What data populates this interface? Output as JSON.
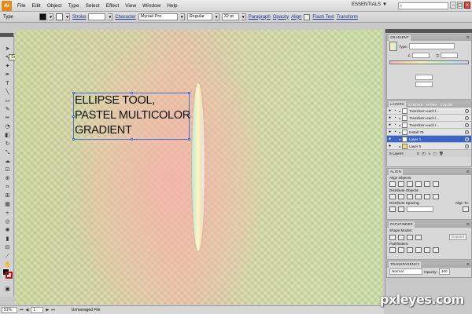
{
  "menubar": {
    "logo": "Ai",
    "items": [
      "File",
      "Edit",
      "Object",
      "Type",
      "Select",
      "Effect",
      "View",
      "Window",
      "Help"
    ],
    "workspace": "ESSENTIALS",
    "workspace_arrow": "▼"
  },
  "control_bar": {
    "selection_type": "Type",
    "stroke_label": "Stroke",
    "character_label": "Character",
    "font_family": "Myriad Pro",
    "font_style": "Regular",
    "font_size": "32 pt",
    "paragraph_label": "Paragraph",
    "opacity_label": "Opacity",
    "align_label": "Align",
    "flash_text_label": "Flash Text",
    "transform_label": "Transform"
  },
  "toolbox": {
    "tooltip": "Selection Tool (V)"
  },
  "canvas": {
    "text_lines": [
      "ELLIPSE TOOL,",
      "PASTEL MULTICOLOR",
      "GRADIENT"
    ]
  },
  "statusbar": {
    "zoom": "51%",
    "artboard": "1",
    "status_text": "Unmanaged File"
  },
  "panels": {
    "gradient": {
      "tab": "GRADIENT",
      "type_label": "Type:"
    },
    "layers": {
      "tabs": [
        "LAYERS",
        "STROKE",
        "APPEA",
        "COLOR"
      ],
      "rows": [
        {
          "name": "Transform each l..."
        },
        {
          "name": "Transform each l..."
        },
        {
          "name": "Transform each l..."
        },
        {
          "name": "Install 79"
        },
        {
          "name": "Layer 1"
        },
        {
          "name": "Layer 5"
        }
      ],
      "footer": "5 Layers"
    },
    "align": {
      "tab": "ALIGN",
      "align_objects": "Align Objects:",
      "distribute_objects": "Distribute Objects:",
      "distribute_spacing": "Distribute Spacing:",
      "align_to": "Align To:"
    },
    "pathfinder": {
      "tab": "PATHFINDER",
      "shape_modes": "Shape Modes:",
      "expand": "Expand",
      "pathfinders": "Pathfinders:"
    },
    "transparency": {
      "tab": "TRANSPARENCY",
      "blend_mode": "Normal",
      "opacity_label": "Opacity:",
      "opacity_value": "100"
    }
  },
  "watermark": "pxleyes.com",
  "colors": {
    "accent_selection": "#3a64c8",
    "canvas_green": "#cbd79a",
    "canvas_pink": "#f5b2a8",
    "app_logo": "#e48a12"
  }
}
